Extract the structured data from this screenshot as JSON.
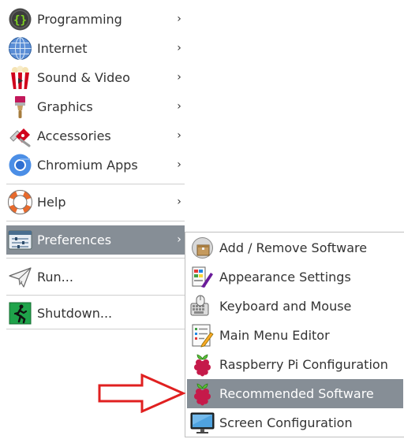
{
  "main_menu": {
    "items": [
      {
        "label": "Programming",
        "icon": "programming-icon"
      },
      {
        "label": "Internet",
        "icon": "globe-icon"
      },
      {
        "label": "Sound & Video",
        "icon": "popcorn-icon"
      },
      {
        "label": "Graphics",
        "icon": "paintbrush-icon"
      },
      {
        "label": "Accessories",
        "icon": "pocket-knife-icon"
      },
      {
        "label": "Chromium Apps",
        "icon": "chromium-icon"
      },
      {
        "label": "Help",
        "icon": "lifebuoy-icon"
      },
      {
        "label": "Preferences",
        "icon": "preferences-icon",
        "selected": true
      },
      {
        "label": "Run...",
        "icon": "paper-plane-icon"
      },
      {
        "label": "Shutdown...",
        "icon": "exit-icon"
      }
    ],
    "chevron": "›"
  },
  "preferences_submenu": {
    "items": [
      {
        "label": "Add / Remove Software",
        "icon": "package-icon"
      },
      {
        "label": "Appearance Settings",
        "icon": "appearance-icon"
      },
      {
        "label": "Keyboard and Mouse",
        "icon": "keyboard-mouse-icon"
      },
      {
        "label": "Main Menu Editor",
        "icon": "menu-editor-icon"
      },
      {
        "label": "Raspberry Pi Configuration",
        "icon": "raspberry-icon"
      },
      {
        "label": "Recommended Software",
        "icon": "raspberry-icon",
        "selected": true
      },
      {
        "label": "Screen Configuration",
        "icon": "monitor-icon"
      }
    ]
  },
  "colors": {
    "selection": "#868e96",
    "annotation_arrow": "#e02020"
  }
}
